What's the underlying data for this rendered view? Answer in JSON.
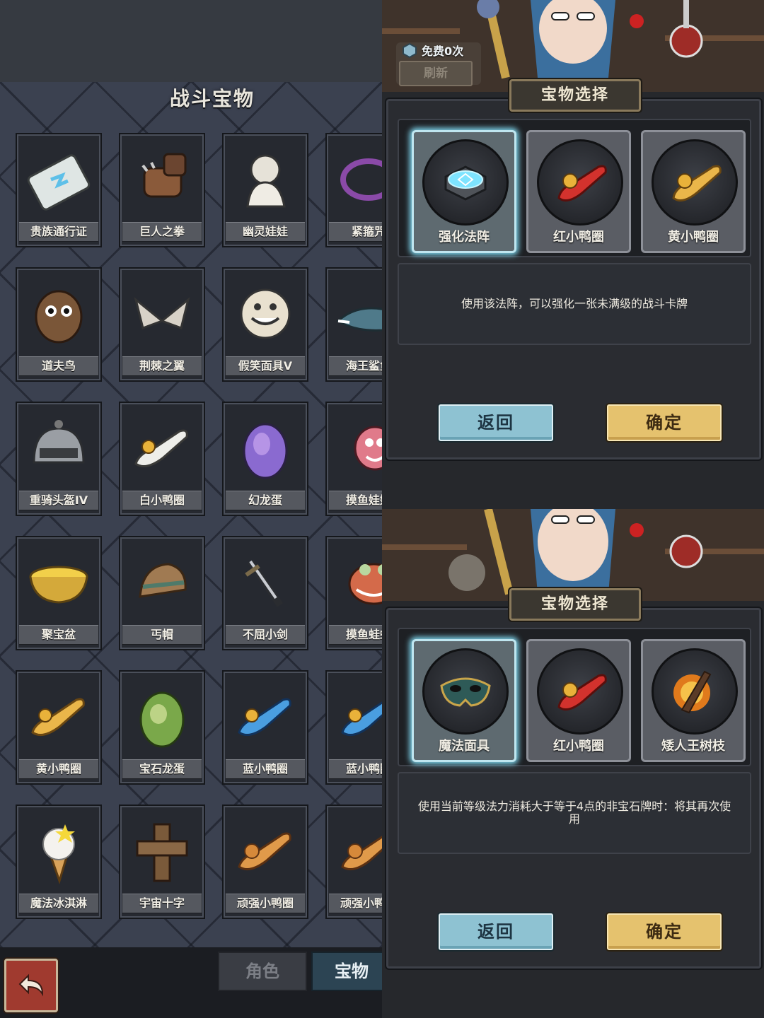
{
  "left_panel": {
    "title": "战斗宝物",
    "items": [
      {
        "name": "贵族通行证",
        "icon": "card-icon"
      },
      {
        "name": "巨人之拳",
        "icon": "fist-icon"
      },
      {
        "name": "幽灵娃娃",
        "icon": "ghost-doll-icon"
      },
      {
        "name": "紧箍咒",
        "icon": "headband-icon"
      },
      {
        "name": "道夫鸟",
        "icon": "owl-icon"
      },
      {
        "name": "荆棘之翼",
        "icon": "thorn-wings-icon"
      },
      {
        "name": "假笑面具V",
        "icon": "grin-mask-icon"
      },
      {
        "name": "海王鲨鱼",
        "icon": "shark-icon"
      },
      {
        "name": "重骑头盔IV",
        "icon": "helmet-icon"
      },
      {
        "name": "白小鸭圈",
        "icon": "white-duck-ring-icon"
      },
      {
        "name": "幻龙蛋",
        "icon": "dragon-egg-icon"
      },
      {
        "name": "摸鱼娃娃",
        "icon": "pink-doll-icon"
      },
      {
        "name": "聚宝盆",
        "icon": "treasure-bowl-icon"
      },
      {
        "name": "丐帽",
        "icon": "beggar-hat-icon"
      },
      {
        "name": "不屈小剑",
        "icon": "sword-icon"
      },
      {
        "name": "摸鱼蛙蛙",
        "icon": "frog-icon"
      },
      {
        "name": "黄小鸭圈",
        "icon": "yellow-duck-ring-icon"
      },
      {
        "name": "宝石龙蛋",
        "icon": "gem-egg-icon"
      },
      {
        "name": "蓝小鸭圈",
        "icon": "blue-duck-ring-icon"
      },
      {
        "name": "蓝小鸭圈",
        "icon": "blue-duck-ring-icon"
      },
      {
        "name": "魔法冰淇淋",
        "icon": "ice-cream-icon"
      },
      {
        "name": "宇宙十字",
        "icon": "cross-icon"
      },
      {
        "name": "顽强小鸭圈",
        "icon": "tough-duck-ring-icon"
      },
      {
        "name": "顽强小鸭圈",
        "icon": "tough-duck-ring-icon"
      }
    ],
    "tabs": {
      "role": "角色",
      "treasure": "宝物"
    }
  },
  "dialog_top": {
    "free_text": "免费0次",
    "refresh_label": "刷新",
    "title": "宝物选择",
    "choices": [
      {
        "name": "强化法阵",
        "icon": "rune-circle-icon",
        "selected": true
      },
      {
        "name": "红小鸭圈",
        "icon": "red-duck-ring-icon",
        "selected": false
      },
      {
        "name": "黄小鸭圈",
        "icon": "yellow-duck-ring-icon",
        "selected": false
      }
    ],
    "description": "使用该法阵，可以强化一张未满级的战斗卡牌",
    "back_label": "返回",
    "confirm_label": "确定"
  },
  "dialog_bottom": {
    "title": "宝物选择",
    "choices": [
      {
        "name": "魔法面具",
        "icon": "magic-mask-icon",
        "selected": true
      },
      {
        "name": "红小鸭圈",
        "icon": "red-duck-ring-icon",
        "selected": false
      },
      {
        "name": "矮人王树枝",
        "icon": "burning-branch-icon",
        "selected": false
      }
    ],
    "description": "使用当前等级法力消耗大于等于4点的非宝石牌时：将其再次使用",
    "back_label": "返回",
    "confirm_label": "确定"
  }
}
